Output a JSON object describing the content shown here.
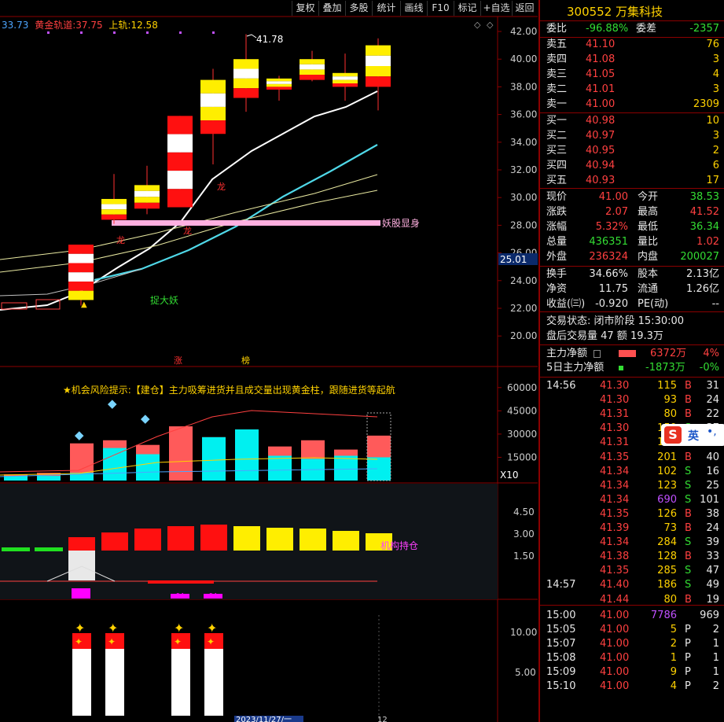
{
  "toolbar": [
    "复权",
    "叠加",
    "多股",
    "统计",
    "画线",
    "F10",
    "标记",
    "+自选",
    "返回"
  ],
  "top_legend": {
    "v1": "33.73",
    "gold_label": "黄金轨道:",
    "gold_val": "37.75",
    "up_label": "上轨:",
    "up_val": "12.58"
  },
  "main_chart": {
    "yticks": [
      "42.00",
      "40.00",
      "38.00",
      "36.00",
      "34.00",
      "32.00",
      "30.00",
      "28.00",
      "26.00",
      "24.00",
      "22.00",
      "20.00"
    ],
    "current_price_tag": "25.01",
    "max_label": "41.78",
    "annotations": {
      "yaogu": "妖股显身",
      "zhuo": "捉大妖",
      "long1": "龙",
      "long2": "龙",
      "long3": "龙",
      "zhang": "涨",
      "bang": "榜"
    },
    "candles": [
      {
        "o": 22.6,
        "c": 26.6,
        "h": 26.6,
        "l": 22.2
      },
      {
        "o": 28.4,
        "c": 29.9,
        "h": 31.7,
        "l": 28.1
      },
      {
        "o": 29.2,
        "c": 30.9,
        "h": 32.3,
        "l": 28.8
      },
      {
        "o": 29.3,
        "c": 35.9,
        "h": 35.9,
        "l": 29.3
      },
      {
        "o": 34.6,
        "c": 38.5,
        "h": 39.3,
        "l": 32.4
      },
      {
        "o": 37.2,
        "c": 40.0,
        "h": 41.8,
        "l": 36.2
      },
      {
        "o": 37.8,
        "c": 38.6,
        "h": 38.8,
        "l": 37.0
      },
      {
        "o": 38.5,
        "c": 40.0,
        "h": 40.6,
        "l": 38.4
      },
      {
        "o": 38.0,
        "c": 39.0,
        "h": 40.4,
        "l": 37.0
      },
      {
        "o": 38.0,
        "c": 41.0,
        "h": 41.5,
        "l": 36.3
      }
    ]
  },
  "vol_panel": {
    "hint": "★机会风险提示:【建仓】主力吸筹进货并且成交量出现黄金柱，跟随进货等起航",
    "yticks": [
      "60000",
      "45000",
      "30000",
      "15000"
    ],
    "x10": "X10",
    "bars": [
      4000,
      5000,
      24000,
      26000,
      23000,
      35000,
      28000,
      33000,
      22000,
      26000,
      20000,
      29000
    ],
    "cyan": [
      3000,
      3000,
      5000,
      21000,
      17000,
      0,
      28000,
      33000,
      16000,
      14000,
      16000,
      15000
    ]
  },
  "ind_panel": {
    "yticks": [
      "4.50",
      "3.00",
      "1.50"
    ],
    "label": "机构持仓",
    "small1": "70",
    "small2": "54",
    "small3": "54"
  },
  "bot_panel": {
    "yticks": [
      "10.00",
      "5.00"
    ],
    "date_label": "2023/11/27/一",
    "r12": "12"
  },
  "quote": {
    "code": "300552",
    "name": "万集科技",
    "weibi_l": "委比",
    "weibi": "-96.88%",
    "weicha_l": "委差",
    "weicha": "-2357",
    "sells": [
      {
        "l": "卖五",
        "p": "41.10",
        "v": "76"
      },
      {
        "l": "卖四",
        "p": "41.08",
        "v": "3"
      },
      {
        "l": "卖三",
        "p": "41.05",
        "v": "4"
      },
      {
        "l": "卖二",
        "p": "41.01",
        "v": "3"
      },
      {
        "l": "卖一",
        "p": "41.00",
        "v": "2309"
      }
    ],
    "buys": [
      {
        "l": "买一",
        "p": "40.98",
        "v": "10"
      },
      {
        "l": "买二",
        "p": "40.97",
        "v": "3"
      },
      {
        "l": "买三",
        "p": "40.95",
        "v": "2"
      },
      {
        "l": "买四",
        "p": "40.94",
        "v": "6"
      },
      {
        "l": "买五",
        "p": "40.93",
        "v": "17"
      }
    ],
    "stats": [
      {
        "l": "现价",
        "v": "41.00",
        "vc": "red",
        "l2": "今开",
        "v2": "38.53",
        "v2c": "grn"
      },
      {
        "l": "涨跌",
        "v": "2.07",
        "vc": "red",
        "l2": "最高",
        "v2": "41.52",
        "v2c": "red"
      },
      {
        "l": "涨幅",
        "v": "5.32%",
        "vc": "red",
        "l2": "最低",
        "v2": "36.34",
        "v2c": "grn"
      },
      {
        "l": "总量",
        "v": "436351",
        "vc": "grn",
        "l2": "量比",
        "v2": "1.02",
        "v2c": "red"
      },
      {
        "l": "外盘",
        "v": "236324",
        "vc": "red",
        "l2": "内盘",
        "v2": "200027",
        "v2c": "grn"
      }
    ],
    "stats2": [
      {
        "l": "换手",
        "v": "34.66%",
        "l2": "股本",
        "v2": "2.13亿"
      },
      {
        "l": "净资",
        "v": "11.75",
        "l2": "流通",
        "v2": "1.26亿"
      },
      {
        "l": "收益(㈢)",
        "v": "-0.920",
        "l2": "PE(动)",
        "v2": "--"
      }
    ],
    "trade_status": "交易状态: 闭市阶段 15:30:00",
    "after_hours": "盘后交易量 47 额 19.3万",
    "flow1_l": "主力净额",
    "flow1_v": "6372万",
    "flow1_p": "4%",
    "flow2_l": "5日主力净额",
    "flow2_v": "-1873万",
    "flow2_p": "-0%",
    "ticks": [
      {
        "t": "14:56",
        "p": "41.30",
        "v": "115",
        "d": "B",
        "n": "31"
      },
      {
        "t": "",
        "p": "41.30",
        "v": "93",
        "d": "B",
        "n": "24"
      },
      {
        "t": "",
        "p": "41.31",
        "v": "80",
        "d": "B",
        "n": "22"
      },
      {
        "t": "",
        "p": "41.30",
        "v": "159",
        "d": "S",
        "n": "37"
      },
      {
        "t": "",
        "p": "41.31",
        "v": "100",
        "d": "B",
        "n": "31"
      },
      {
        "t": "",
        "p": "41.35",
        "v": "201",
        "d": "B",
        "n": "40"
      },
      {
        "t": "",
        "p": "41.34",
        "v": "102",
        "d": "S",
        "n": "16"
      },
      {
        "t": "",
        "p": "41.34",
        "v": "123",
        "d": "S",
        "n": "25"
      },
      {
        "t": "",
        "p": "41.34",
        "v": "690",
        "d": "S",
        "n": "101"
      },
      {
        "t": "",
        "p": "41.35",
        "v": "126",
        "d": "B",
        "n": "38"
      },
      {
        "t": "",
        "p": "41.39",
        "v": "73",
        "d": "B",
        "n": "24"
      },
      {
        "t": "",
        "p": "41.34",
        "v": "284",
        "d": "S",
        "n": "39"
      },
      {
        "t": "",
        "p": "41.38",
        "v": "128",
        "d": "B",
        "n": "33"
      },
      {
        "t": "",
        "p": "41.35",
        "v": "285",
        "d": "S",
        "n": "47"
      },
      {
        "t": "14:57",
        "p": "41.40",
        "v": "186",
        "d": "S",
        "n": "49"
      },
      {
        "t": "",
        "p": "41.44",
        "v": "80",
        "d": "B",
        "n": "19"
      },
      {
        "t": "15:00",
        "p": "41.00",
        "v": "7786",
        "d": "",
        "n": "969"
      },
      {
        "t": "15:05",
        "p": "41.00",
        "v": "5",
        "d": "P",
        "n": "2"
      },
      {
        "t": "15:07",
        "p": "41.00",
        "v": "2",
        "d": "P",
        "n": "1"
      },
      {
        "t": "15:08",
        "p": "41.00",
        "v": "1",
        "d": "P",
        "n": "1"
      },
      {
        "t": "15:09",
        "p": "41.00",
        "v": "9",
        "d": "P",
        "n": "1"
      },
      {
        "t": "15:10",
        "p": "41.00",
        "v": "4",
        "d": "P",
        "n": "2"
      }
    ],
    "ime": "英"
  }
}
